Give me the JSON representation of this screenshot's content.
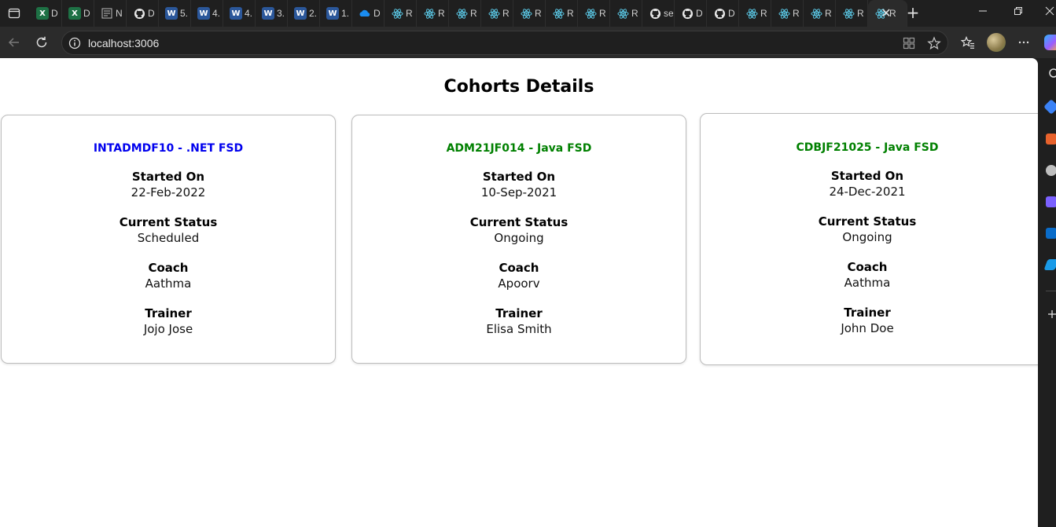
{
  "browser": {
    "tabs": [
      {
        "icon": "excel-icon",
        "glyph": "X",
        "label": "D",
        "kind": "excel"
      },
      {
        "icon": "excel-icon",
        "glyph": "X",
        "label": "D",
        "kind": "excel"
      },
      {
        "icon": "notion-icon",
        "glyph": "",
        "label": "N",
        "kind": "notion"
      },
      {
        "icon": "github-icon",
        "glyph": "",
        "label": "D",
        "kind": "gh"
      },
      {
        "icon": "word-icon",
        "glyph": "W",
        "label": "5.",
        "kind": "word"
      },
      {
        "icon": "word-icon",
        "glyph": "W",
        "label": "4.",
        "kind": "word"
      },
      {
        "icon": "word-icon",
        "glyph": "W",
        "label": "4.",
        "kind": "word"
      },
      {
        "icon": "word-icon",
        "glyph": "W",
        "label": "3.",
        "kind": "word"
      },
      {
        "icon": "word-icon",
        "glyph": "W",
        "label": "2.",
        "kind": "word"
      },
      {
        "icon": "word-icon",
        "glyph": "W",
        "label": "1.",
        "kind": "word"
      },
      {
        "icon": "onedrive-icon",
        "glyph": "",
        "label": "D",
        "kind": "od"
      },
      {
        "icon": "react-icon",
        "glyph": "",
        "label": "R",
        "kind": "react"
      },
      {
        "icon": "react-icon",
        "glyph": "",
        "label": "R",
        "kind": "react"
      },
      {
        "icon": "react-icon",
        "glyph": "",
        "label": "R",
        "kind": "react"
      },
      {
        "icon": "react-icon",
        "glyph": "",
        "label": "R",
        "kind": "react"
      },
      {
        "icon": "react-icon",
        "glyph": "",
        "label": "R",
        "kind": "react"
      },
      {
        "icon": "react-icon",
        "glyph": "",
        "label": "R",
        "kind": "react"
      },
      {
        "icon": "react-icon",
        "glyph": "",
        "label": "R",
        "kind": "react"
      },
      {
        "icon": "react-icon",
        "glyph": "",
        "label": "R",
        "kind": "react"
      },
      {
        "icon": "github-icon",
        "glyph": "",
        "label": "se",
        "kind": "gh"
      },
      {
        "icon": "github-icon",
        "glyph": "",
        "label": "D",
        "kind": "gh"
      },
      {
        "icon": "github-icon",
        "glyph": "",
        "label": "D",
        "kind": "gh"
      },
      {
        "icon": "react-icon",
        "glyph": "",
        "label": "R",
        "kind": "react"
      },
      {
        "icon": "react-icon",
        "glyph": "",
        "label": "R",
        "kind": "react"
      },
      {
        "icon": "react-icon",
        "glyph": "",
        "label": "R",
        "kind": "react"
      },
      {
        "icon": "react-icon",
        "glyph": "",
        "label": "R",
        "kind": "react"
      },
      {
        "icon": "react-icon",
        "glyph": "",
        "label": "R",
        "kind": "react",
        "active": true
      }
    ],
    "close_tab": "✕",
    "new_tab": "+",
    "url": "localhost:3006"
  },
  "page": {
    "title": "Cohorts Details",
    "cohorts": [
      {
        "name": "INTADMDF10 - .NET FSD",
        "name_color": "#0000ee",
        "started_on_label": "Started On",
        "started_on": "22-Feb-2022",
        "status_label": "Current Status",
        "status": "Scheduled",
        "coach_label": "Coach",
        "coach": "Aathma",
        "trainer_label": "Trainer",
        "trainer": "Jojo Jose"
      },
      {
        "name": "ADM21JF014 - Java FSD",
        "name_color": "#008000",
        "started_on_label": "Started On",
        "started_on": "10-Sep-2021",
        "status_label": "Current Status",
        "status": "Ongoing",
        "coach_label": "Coach",
        "coach": "Apoorv",
        "trainer_label": "Trainer",
        "trainer": "Elisa Smith"
      },
      {
        "name": "CDBJF21025 - Java FSD",
        "name_color": "#008000",
        "started_on_label": "Started On",
        "started_on": "24-Dec-2021",
        "status_label": "Current Status",
        "status": "Ongoing",
        "coach_label": "Coach",
        "coach": "Aathma",
        "trainer_label": "Trainer",
        "trainer": "John Doe"
      }
    ]
  }
}
